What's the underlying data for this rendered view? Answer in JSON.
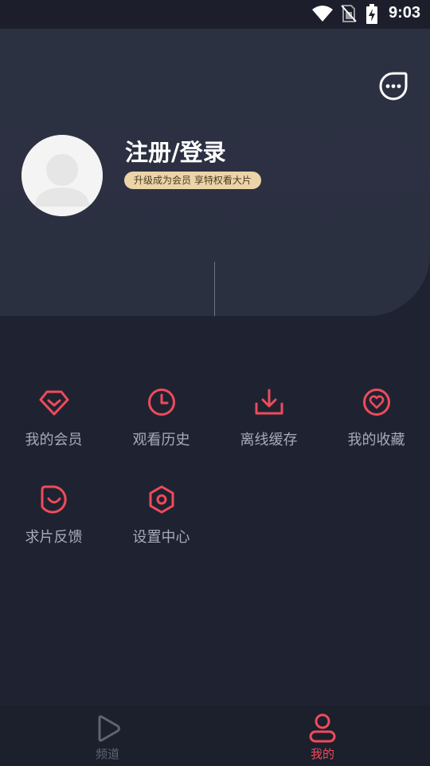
{
  "status_bar": {
    "time": "9:03"
  },
  "header": {
    "login_title": "注册/登录",
    "member_badge": "升级成为会员 享特权看大片"
  },
  "menu": {
    "items": [
      {
        "label": "我的会员",
        "icon": "diamond-icon"
      },
      {
        "label": "观看历史",
        "icon": "clock-icon"
      },
      {
        "label": "离线缓存",
        "icon": "download-icon"
      },
      {
        "label": "我的收藏",
        "icon": "heart-icon"
      },
      {
        "label": "求片反馈",
        "icon": "feedback-icon"
      },
      {
        "label": "设置中心",
        "icon": "settings-icon"
      }
    ]
  },
  "bottom_nav": {
    "tabs": [
      {
        "label": "频道",
        "icon": "play-icon",
        "active": false
      },
      {
        "label": "我的",
        "icon": "user-icon",
        "active": true
      }
    ]
  },
  "colors": {
    "accent": "#ee4b5c",
    "inactive": "#5f6473",
    "background": "#1f2331",
    "header": "#2c3142",
    "badge": "#ecd4a8"
  }
}
